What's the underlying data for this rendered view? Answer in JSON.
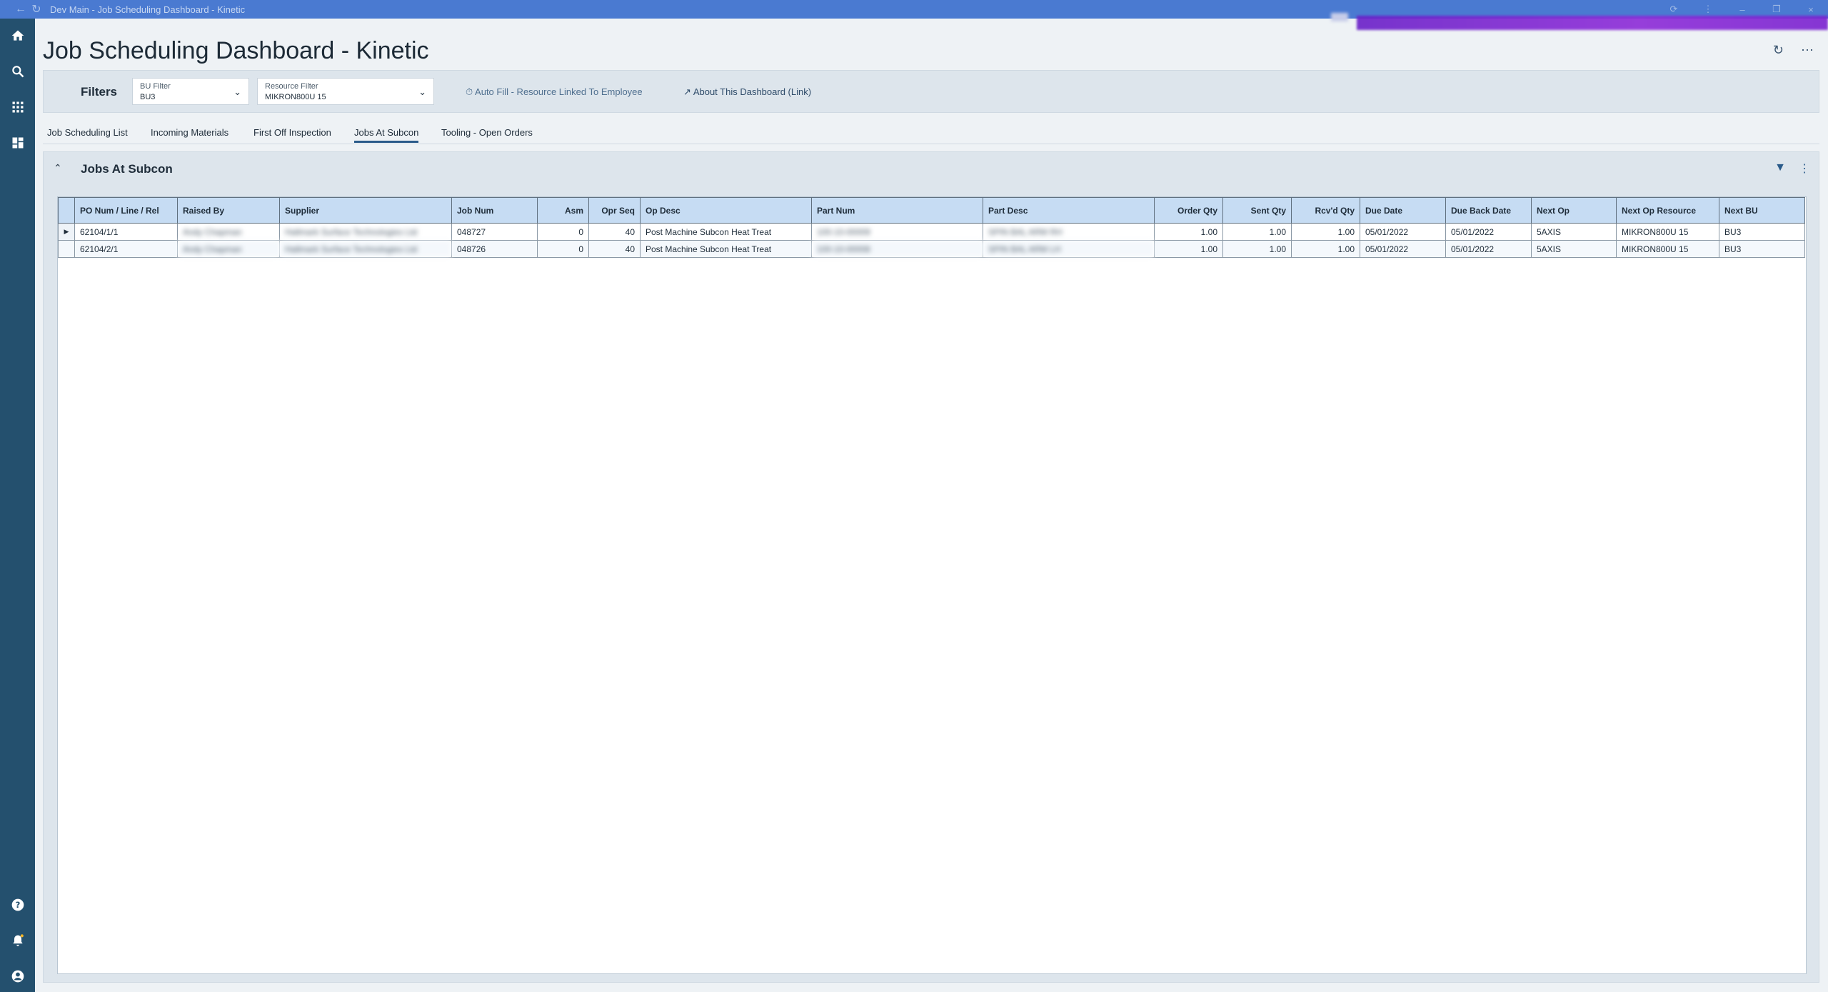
{
  "window": {
    "title": "Dev Main - Job Scheduling Dashboard - Kinetic"
  },
  "page": {
    "title": "Job Scheduling Dashboard - Kinetic"
  },
  "filters": {
    "label": "Filters",
    "bu_filter": {
      "label": "BU Filter",
      "value": "BU3"
    },
    "resource_filter": {
      "label": "Resource Filter",
      "value": "MIKRON800U 15"
    },
    "auto_fill_link": "Auto Fill - Resource Linked To Employee",
    "about_link": "About This Dashboard (Link)"
  },
  "tabs": [
    {
      "label": "Job Scheduling List"
    },
    {
      "label": "Incoming Materials"
    },
    {
      "label": "First Off Inspection"
    },
    {
      "label": "Jobs At Subcon"
    },
    {
      "label": "Tooling - Open Orders"
    }
  ],
  "panel": {
    "title": "Jobs At Subcon"
  },
  "grid": {
    "columns": [
      "PO Num / Line / Rel",
      "Raised By",
      "Supplier",
      "Job Num",
      "Asm",
      "Opr Seq",
      "Op Desc",
      "Part Num",
      "Part Desc",
      "Order Qty",
      "Sent Qty",
      "Rcv'd Qty",
      "Due Date",
      "Due Back Date",
      "Next Op",
      "Next Op Resource",
      "Next BU"
    ],
    "rows": [
      [
        "62104/1/1",
        "Andy Chapman",
        "Hallmark Surface Technologies Ltd",
        "048727",
        "0",
        "40",
        "Post Machine Subcon Heat Treat",
        "100-10-00009",
        "SPIN BAL ARM RH",
        "1.00",
        "1.00",
        "1.00",
        "05/01/2022",
        "05/01/2022",
        "5AXIS",
        "MIKRON800U 15",
        "BU3"
      ],
      [
        "62104/2/1",
        "Andy Chapman",
        "Hallmark Surface Technologies Ltd",
        "048726",
        "0",
        "40",
        "Post Machine Subcon Heat Treat",
        "100-10-00008",
        "SPIN BAL ARM LH",
        "1.00",
        "1.00",
        "1.00",
        "05/01/2022",
        "05/01/2022",
        "5AXIS",
        "MIKRON800U 15",
        "BU3"
      ]
    ]
  },
  "colors": {
    "titlebar": "#4a7ad1",
    "sidenav": "#24506e",
    "header_bg": "#c6dcf3",
    "accent": "#2a5b8a"
  },
  "icons": {
    "sidenav": [
      "home-icon",
      "search-icon",
      "apps-grid-icon",
      "dashboard-icon",
      "help-icon",
      "notifications-icon",
      "user-account-icon"
    ]
  }
}
